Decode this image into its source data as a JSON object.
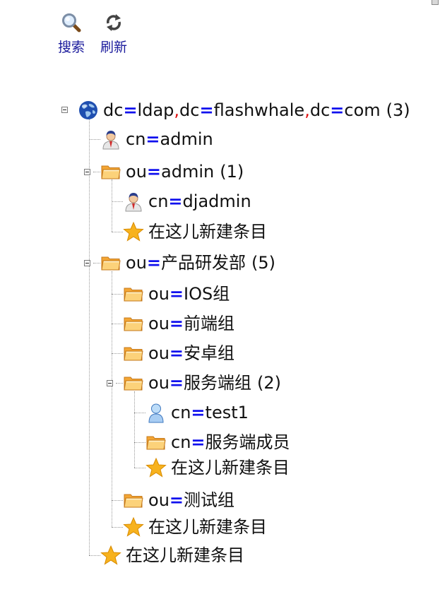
{
  "toolbar": {
    "search": {
      "label": "搜索",
      "icon": "magnifier-icon"
    },
    "refresh": {
      "label": "刷新",
      "icon": "refresh-icon"
    }
  },
  "tree": {
    "root": {
      "dn": "dc=ldap,dc=flashwhale,dc=com",
      "count": "(3)",
      "icon": "globe-icon"
    },
    "nodes": [
      {
        "id": "n1",
        "rdn": "cn=admin",
        "icon": "user-icon",
        "depth": 1
      },
      {
        "id": "n2",
        "rdn": "ou=admin",
        "count": "(1)",
        "icon": "folder-icon",
        "depth": 1,
        "expanded": true
      },
      {
        "id": "n3",
        "rdn": "cn=djadmin",
        "icon": "user-icon",
        "depth": 2
      },
      {
        "id": "n4",
        "label": "在这儿新建条目",
        "icon": "star-icon",
        "depth": 2
      },
      {
        "id": "n5",
        "rdn": "ou=产品研发部",
        "count": "(5)",
        "icon": "folder-icon",
        "depth": 1,
        "expanded": true
      },
      {
        "id": "n6",
        "rdn": "ou=IOS组",
        "icon": "folder-icon",
        "depth": 2
      },
      {
        "id": "n7",
        "rdn": "ou=前端组",
        "icon": "folder-icon",
        "depth": 2
      },
      {
        "id": "n8",
        "rdn": "ou=安卓组",
        "icon": "folder-icon",
        "depth": 2
      },
      {
        "id": "n9",
        "rdn": "ou=服务端组",
        "count": "(2)",
        "icon": "folder-icon",
        "depth": 2,
        "expanded": true
      },
      {
        "id": "n10",
        "rdn": "cn=test1",
        "icon": "person-icon",
        "depth": 3
      },
      {
        "id": "n11",
        "rdn": "cn=服务端成员",
        "icon": "folder-icon",
        "depth": 3
      },
      {
        "id": "n12",
        "label": "在这儿新建条目",
        "icon": "star-icon",
        "depth": 3
      },
      {
        "id": "n13",
        "rdn": "ou=测试组",
        "icon": "folder-icon",
        "depth": 2
      },
      {
        "id": "n14",
        "label": "在这儿新建条目",
        "icon": "star-icon",
        "depth": 2
      },
      {
        "id": "n15",
        "label": "在这儿新建条目",
        "icon": "star-icon",
        "depth": 1
      }
    ]
  },
  "colors": {
    "link": "#1a1a9c",
    "equals": "#1010ee",
    "comma": "#e01010",
    "text": "#111111"
  }
}
